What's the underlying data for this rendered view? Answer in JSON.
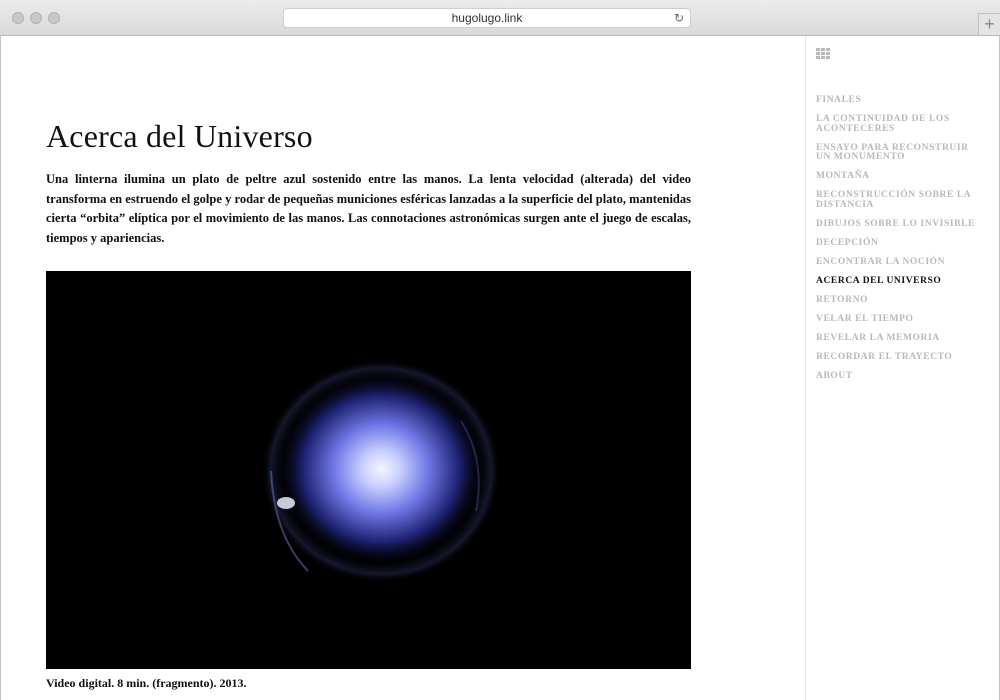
{
  "browser": {
    "url": "hugolugo.link",
    "reload_icon": "↻",
    "new_tab_label": "+"
  },
  "article": {
    "title": "Acerca del Universo",
    "description": "Una linterna ilumina un plato de peltre azul sostenido entre las manos. La lenta velocidad (alterada) del video transforma en estruendo el golpe y rodar de pequeñas municiones esféricas lanzadas a la superficie del plato, mantenidas cierta “orbita” elíptica por el movimiento de las manos. Las connotaciones astronómicas surgen ante el juego de escalas, tiempos y apariencias.",
    "caption": "Video digital. 8 min. (fragmento). 2013."
  },
  "sidebar": {
    "menu_icon": "grid-icon",
    "items": [
      {
        "label": "FINALES",
        "active": false
      },
      {
        "label": "LA CONTINUIDAD DE LOS ACONTECERES",
        "active": false
      },
      {
        "label": "ENSAYO PARA RECONSTRUIR UN MONUMENTO",
        "active": false
      },
      {
        "label": "MONTAÑA",
        "active": false
      },
      {
        "label": "RECONSTRUCCIÓN SOBRE LA DISTANCIA",
        "active": false
      },
      {
        "label": "DIBUJOS SOBRE LO INVISIBLE",
        "active": false
      },
      {
        "label": "DECEPCIÓN",
        "active": false
      },
      {
        "label": "ENCONTRAR LA NOCIÓN",
        "active": false
      },
      {
        "label": "ACERCA DEL UNIVERSO",
        "active": true
      },
      {
        "label": "RETORNO",
        "active": false
      },
      {
        "label": "VELAR EL TIEMPO",
        "active": false
      },
      {
        "label": "REVELAR LA MEMORIA",
        "active": false
      },
      {
        "label": "RECORDAR EL TRAYECTO",
        "active": false
      },
      {
        "label": "ABOUT",
        "active": false
      }
    ]
  },
  "colors": {
    "menu_inactive": "#b9b9b9",
    "menu_active": "#111111",
    "video_glow": "#8fa0ff"
  }
}
